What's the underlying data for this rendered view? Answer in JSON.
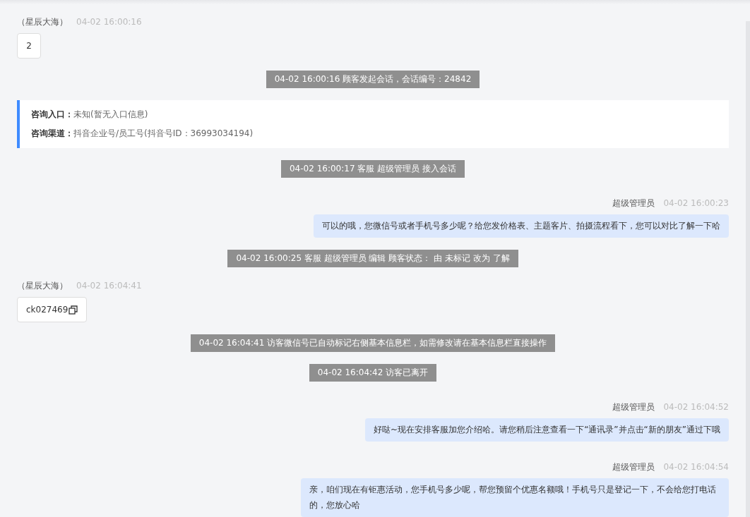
{
  "messages": [
    {
      "kind": "incoming",
      "sender": "（星辰大海）",
      "time": "04-02 16:00:16",
      "text": "2",
      "copyable": false
    },
    {
      "kind": "system",
      "text": "04-02 16:00:16 顾客发起会话，会话编号：24842"
    },
    {
      "kind": "info",
      "rows": [
        {
          "label": "咨询入口：",
          "value": "未知(暂无入口信息)"
        },
        {
          "label": "咨询渠道：",
          "value": "抖音企业号/员工号(抖音号ID：36993034194)"
        }
      ]
    },
    {
      "kind": "system",
      "text": "04-02 16:00:17 客服 超级管理员 接入会话"
    },
    {
      "kind": "outgoing",
      "sender": "超级管理员",
      "time": "04-02 16:00:23",
      "text": "可以的哦，您微信号或者手机号多少呢？给您发价格表、主题客片、拍摄流程看下，您可以对比了解一下哈"
    },
    {
      "kind": "system",
      "text": "04-02 16:00:25 客服 超级管理员 编辑 顾客状态： 由 未标记 改为 了解"
    },
    {
      "kind": "incoming",
      "sender": "（星辰大海）",
      "time": "04-02 16:04:41",
      "text": "ck027469",
      "copyable": true
    },
    {
      "kind": "system",
      "text": "04-02 16:04:41 访客微信号已自动标记右侧基本信息栏，如需修改请在基本信息栏直接操作"
    },
    {
      "kind": "system",
      "text": "04-02 16:04:42 访客已离开"
    },
    {
      "kind": "outgoing",
      "sender": "超级管理员",
      "time": "04-02 16:04:52",
      "text": "好哒~现在安排客服加您介绍哈。请您稍后注意查看一下“通讯录”并点击“新的朋友”通过下哦"
    },
    {
      "kind": "outgoing",
      "sender": "超级管理员",
      "time": "04-02 16:04:54",
      "text": "亲，咱们现在有钜惠活动，您手机号多少呢，帮您预留个优惠名额哦！手机号只是登记一下，不会给您打电话的，您放心哈"
    }
  ]
}
